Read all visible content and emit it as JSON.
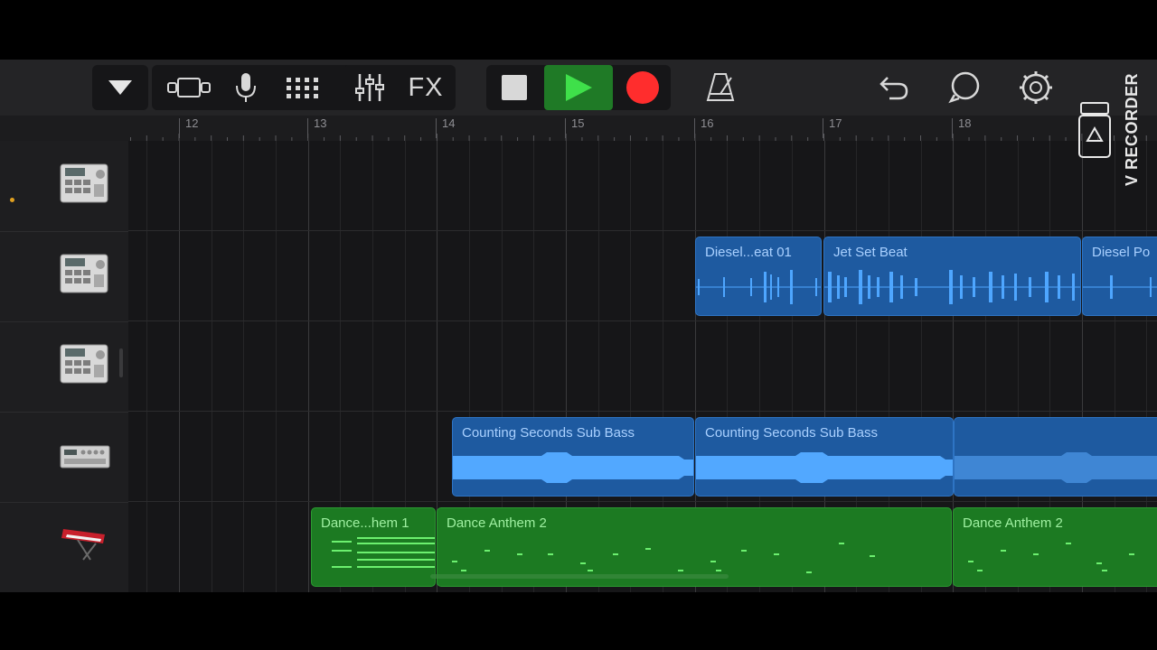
{
  "toolbar": {
    "fx_label": "FX",
    "accent_play": "#2ea836",
    "accent_record": "#ff2d2d"
  },
  "ruler": {
    "bars": [
      "12",
      "13",
      "14",
      "15",
      "16",
      "17",
      "18"
    ]
  },
  "tracks": [
    {
      "instrument": "drum-machine-icon"
    },
    {
      "instrument": "drum-machine-icon"
    },
    {
      "instrument": "drum-machine-icon"
    },
    {
      "instrument": "synth-module-icon"
    },
    {
      "instrument": "keyboard-icon"
    }
  ],
  "regions": {
    "diesel_beat": "Diesel...eat 01",
    "jet_set_beat": "Jet Set Beat",
    "diesel_po": "Diesel Po",
    "counting_1": "Counting Seconds Sub Bass",
    "counting_2": "Counting Seconds Sub Bass",
    "dance_anthem_1": "Dance...hem 1",
    "dance_anthem_2a": "Dance Anthem 2",
    "dance_anthem_2b": "Dance Anthem 2"
  },
  "watermark": {
    "text": "V RECORDER"
  }
}
